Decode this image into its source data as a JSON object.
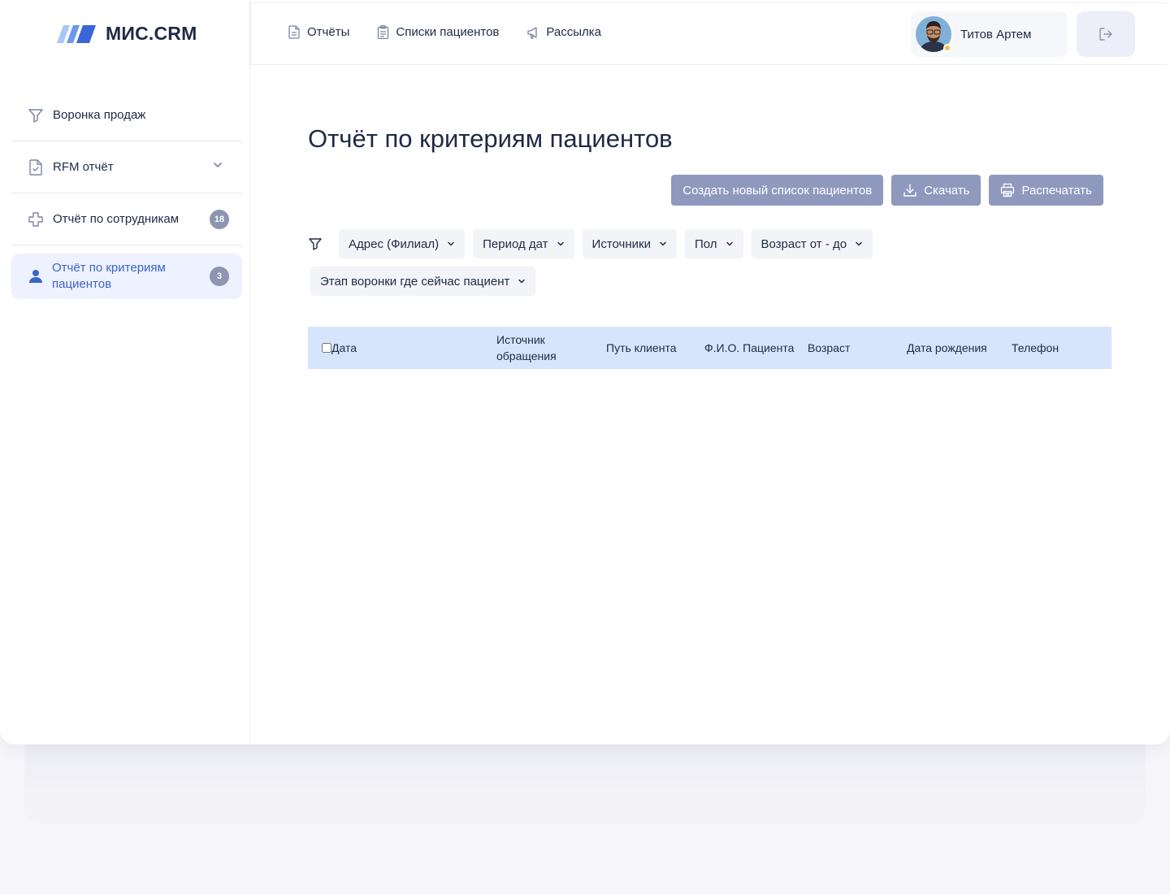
{
  "brand": {
    "name": "МИС.CRM"
  },
  "sidebar": {
    "items": [
      {
        "label": "Воронка продаж",
        "icon": "funnel-icon"
      },
      {
        "label": "RFM отчёт",
        "icon": "document-check-icon",
        "expandable": true
      },
      {
        "label": "Отчёт по сотрудникам",
        "icon": "medical-cross-icon",
        "badge": "18"
      },
      {
        "label": "Отчёт по критериям пациентов",
        "icon": "user-icon",
        "badge": "3",
        "active": true
      }
    ]
  },
  "topbar": {
    "links": [
      {
        "label": "Отчёты",
        "icon": "document-icon"
      },
      {
        "label": "Списки пациентов",
        "icon": "clipboard-icon"
      },
      {
        "label": "Рассылка",
        "icon": "megaphone-icon"
      }
    ],
    "user": {
      "name": "Титов Артем",
      "status_color": "#f3c23a"
    },
    "logout_icon": "logout-icon"
  },
  "main": {
    "title": "Отчёт по критериям пациентов",
    "actions": {
      "create_list": "Создать новый список пациентов",
      "download": "Скачать",
      "print": "Распечатать"
    },
    "filters": [
      "Адрес (Филиал)",
      "Период дат",
      "Источники",
      "Пол",
      "Возраст от - до",
      "Этап воронки где сейчас пациент"
    ],
    "table": {
      "columns": [
        "Дата",
        "Источник обращения",
        "Путь клиента",
        "Ф.И.О. Пациента",
        "Возраст",
        "Дата рождения",
        "Телефон"
      ],
      "rows": []
    }
  },
  "colors": {
    "accent": "#3a66c4",
    "button": "#8f99bd",
    "table_header": "#d6e5fc",
    "active_nav_bg": "#eef1ff",
    "badge": "#8d95b0"
  }
}
